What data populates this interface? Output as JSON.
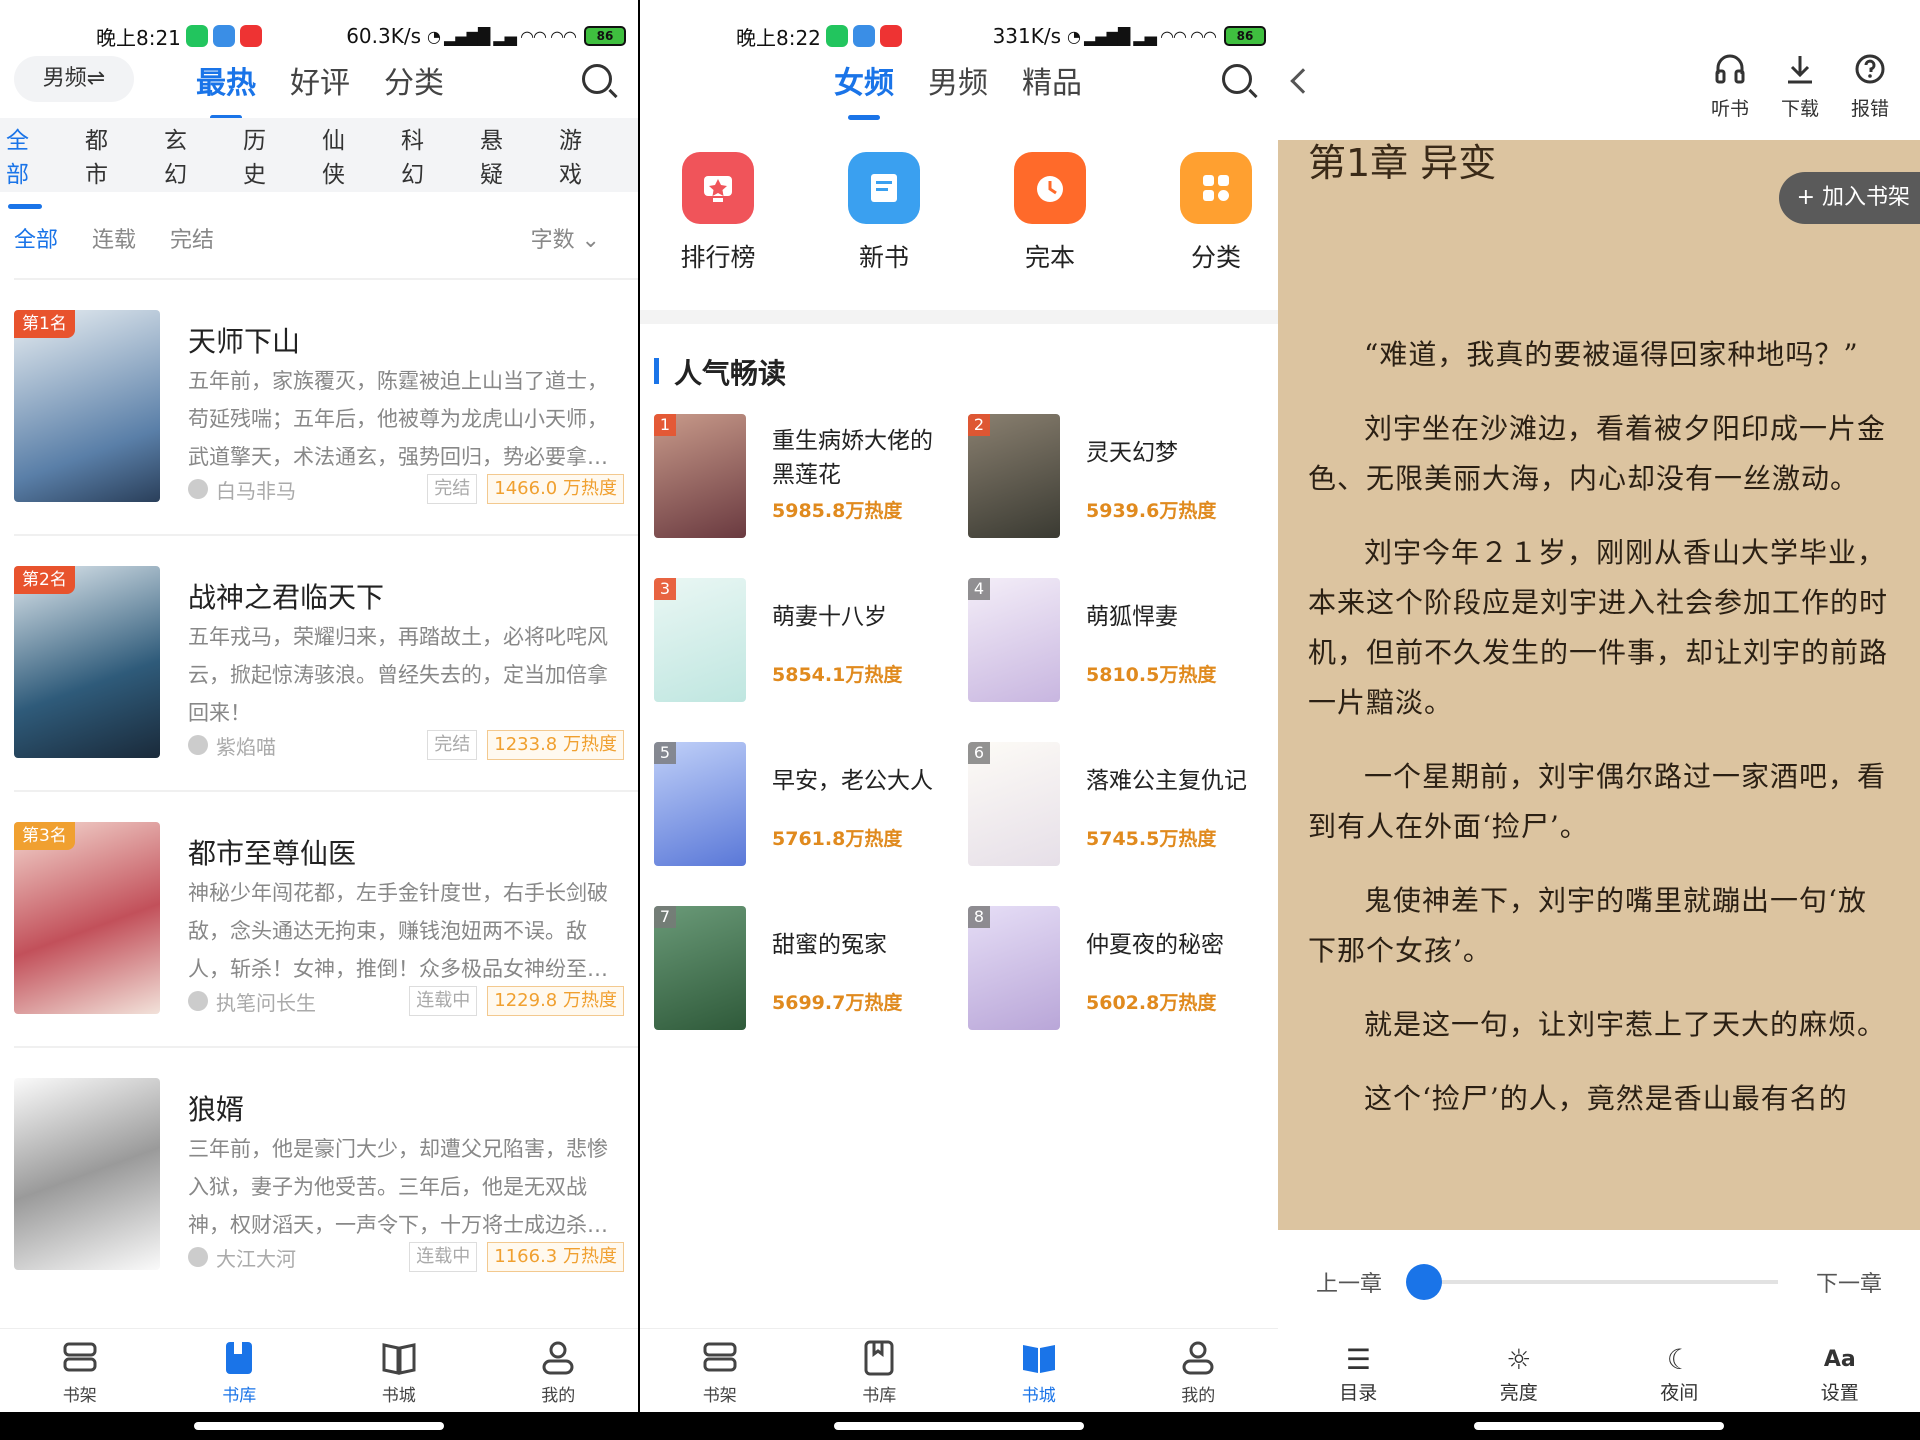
{
  "p1": {
    "status": {
      "time": "晚上8:21",
      "speed": "60.3K/s",
      "battery": "86"
    },
    "gender": "男频⇌",
    "tabs": [
      "最热",
      "好评",
      "分类"
    ],
    "categories": [
      "全部",
      "都市",
      "玄幻",
      "历史",
      "仙侠",
      "科幻",
      "悬疑",
      "游戏"
    ],
    "filters": [
      "全部",
      "连载",
      "完结"
    ],
    "sort": "字数 ⌄",
    "books": [
      {
        "rank": "第1名",
        "title": "天师下山",
        "desc": "五年前，家族覆灭，陈霆被迫上山当了道士，苟延残喘；五年后，他被尊为龙虎山小天师，武道擎天，术法通玄，强势回归，势必要拿…",
        "author": "白马非马",
        "tag": "完结",
        "hot": "1466.0 万热度",
        "color": "#5a7fa8"
      },
      {
        "rank": "第2名",
        "title": "战神之君临天下",
        "desc": "五年戎马，荣耀归来，再踏故土，必将叱咤风云，掀起惊涛骇浪。曾经失去的，定当加倍拿回来！",
        "author": "紫焰喵",
        "tag": "完结",
        "hot": "1233.8 万热度",
        "color": "#2f5b7a"
      },
      {
        "rank": "第3名",
        "title": "都市至尊仙医",
        "desc": "神秘少年闯花都，左手金针度世，右手长剑破敌，念头通达无拘束，赚钱泡妞两不误。敌人，斩杀！女神，推倒！众多极品女神纷至…",
        "author": "执笔问长生",
        "tag": "连载中",
        "hot": "1229.8 万热度",
        "color": "#c2505a"
      },
      {
        "rank": "",
        "title": "狼婿",
        "desc": "三年前，他是豪门大少，却遭父兄陷害，悲惨入狱，妻子为他受苦。三年后，他是无双战神，权财滔天，一声令下，十万将士成边杀…",
        "author": "大江大河",
        "tag": "连载中",
        "hot": "1166.3 万热度",
        "color": "#6a6a6a"
      }
    ],
    "nav": [
      "书架",
      "书库",
      "书城",
      "我的"
    ]
  },
  "p2": {
    "status": {
      "time": "晚上8:22",
      "speed": "331K/s",
      "battery": "86"
    },
    "tabs": [
      "女频",
      "男频",
      "精品"
    ],
    "quick": [
      {
        "label": "排行榜",
        "color": "#f0545a",
        "icon": "trophy-icon"
      },
      {
        "label": "新书",
        "color": "#3aa0f0",
        "icon": "document-icon"
      },
      {
        "label": "完本",
        "color": "#ff6a2a",
        "icon": "clock-icon"
      },
      {
        "label": "分类",
        "color": "#ffa030",
        "icon": "grid-icon"
      }
    ],
    "section": "人气畅读",
    "popular": [
      {
        "num": "1",
        "title": "重生病娇大佬的黑莲花",
        "hot": "5985.8万热度",
        "color": "#6a3a40"
      },
      {
        "num": "2",
        "title": "灵天幻梦",
        "hot": "5939.6万热度",
        "color": "#3a3a32"
      },
      {
        "num": "3",
        "title": "萌妻十八岁",
        "hot": "5854.1万热度",
        "color": "#bfe6e0"
      },
      {
        "num": "4",
        "title": "萌狐悍妻",
        "hot": "5810.5万热度",
        "color": "#c8b6e0"
      },
      {
        "num": "5",
        "title": "早安，老公大人",
        "hot": "5761.8万热度",
        "color": "#5a78d8"
      },
      {
        "num": "6",
        "title": "落难公主复仇记",
        "hot": "5745.5万热度",
        "color": "#e6dfe8"
      },
      {
        "num": "7",
        "title": "甜蜜的冤家",
        "hot": "5699.7万热度",
        "color": "#2f5a3a"
      },
      {
        "num": "8",
        "title": "仲夏夜的秘密",
        "hot": "5602.8万热度",
        "color": "#b9a6d8"
      }
    ],
    "nav": [
      "书架",
      "书库",
      "书城",
      "我的"
    ]
  },
  "p3": {
    "tools": [
      "听书",
      "下载",
      "报错"
    ],
    "chapter": "第1章 异变",
    "add_shelf": "+ 加入书架",
    "paragraphs": [
      "“难道，我真的要被逼得回家种地吗？”",
      "刘宇坐在沙滩边，看着被夕阳印成一片金色、无限美丽大海，内心却没有一丝激动。",
      "刘宇今年２１岁，刚刚从香山大学毕业，本来这个阶段应是刘宇进入社会参加工作的时机，但前不久发生的一件事，却让刘宇的前路一片黯淡。",
      "一个星期前，刘宇偶尔路过一家酒吧，看到有人在外面‘捡尸’。",
      "鬼使神差下，刘宇的嘴里就蹦出一句‘放下那个女孩’。",
      "就是这一句，让刘宇惹上了天大的麻烦。",
      "这个‘捡尸’的人，竟然是香山最有名的"
    ],
    "prev": "上一章",
    "next": "下一章",
    "progress": 0,
    "bottom_tools": [
      {
        "label": "目录",
        "icon": "list-icon"
      },
      {
        "label": "亮度",
        "icon": "sun-icon"
      },
      {
        "label": "夜间",
        "icon": "moon-icon"
      },
      {
        "label": "设置",
        "icon": "font-icon"
      }
    ]
  }
}
